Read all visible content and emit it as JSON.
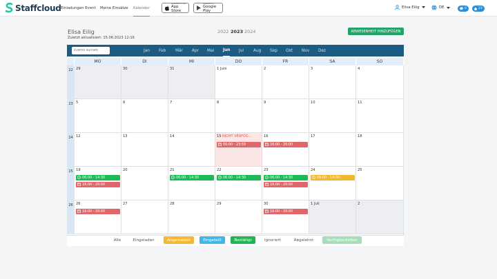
{
  "brand": {
    "name": "Staffcloud",
    "color": "#1f3b57",
    "accent": "#23c7a4"
  },
  "nav": [
    {
      "label": "Einladungen Event"
    },
    {
      "label": "Meine Einsätze"
    },
    {
      "label": "Kalender",
      "active": true
    }
  ],
  "stores": {
    "apple": {
      "small": "Available on the",
      "big": "App Store"
    },
    "google": {
      "small": "Available on",
      "big": "Google Play"
    }
  },
  "user": {
    "name": "Elisa Eilig"
  },
  "language": {
    "code": "DE"
  },
  "pills": {
    "left": "0",
    "right": "23"
  },
  "header": {
    "name": "Elisa Eilig",
    "updated": "Zuletzt aktualisiert: 15.06.2023 12:16",
    "years": [
      "2022",
      "2023",
      "2024"
    ],
    "active_year": "2023",
    "absence_button": "ABWESENHEIT HINZUFÜGEN"
  },
  "search": {
    "placeholder": "Events suchen"
  },
  "months": [
    "Jan",
    "Feb",
    "Mär",
    "Apr",
    "Mai",
    "Jun",
    "Jul",
    "Aug",
    "Sep",
    "Okt",
    "Nov",
    "Dez"
  ],
  "active_month": "Jun",
  "weekdays": [
    "MO",
    "DI",
    "MI",
    "DO",
    "FR",
    "SA",
    "SO"
  ],
  "weeks": [
    {
      "number": "22",
      "days": [
        "29",
        "30",
        "31",
        "1 Juni",
        "2",
        "3",
        "4"
      ]
    },
    {
      "number": "23",
      "days": [
        "5",
        "6",
        "7",
        "8",
        "9",
        "10",
        "11"
      ]
    },
    {
      "number": "24",
      "days": [
        "12",
        "13",
        "14",
        "15",
        "16",
        "17",
        "18"
      ]
    },
    {
      "number": "25",
      "days": [
        "19",
        "20",
        "21",
        "22",
        "23",
        "24",
        "25"
      ]
    },
    {
      "number": "26",
      "days": [
        "26",
        "27",
        "28",
        "29",
        "30",
        "1 Juli",
        "2"
      ]
    }
  ],
  "not_available_label": "NICHT VERFÜG...",
  "events": [
    {
      "time": "00:00 - 23:59"
    },
    {
      "time": "16:00 - 20:00"
    },
    {
      "time": "06:00 - 14:30"
    },
    {
      "time": "16:00 - 20:00"
    },
    {
      "time": "06:00 - 14:30"
    },
    {
      "time": "06:00 - 14:30"
    },
    {
      "time": "06:00 - 14:30"
    },
    {
      "time": "16:00 - 20:00"
    },
    {
      "time": "06:00 - 14:30"
    },
    {
      "time": "16:00 - 20:00"
    },
    {
      "time": "16:00 - 20:00"
    }
  ],
  "legend": [
    "Alle",
    "Eingeladen",
    "Angemeldet",
    "Eingeteilt",
    "Bestätigt",
    "Ignoriert",
    "Abgelehnt",
    "Verfügbarkeiten"
  ],
  "colors": {
    "header_bar": "#1b5c84",
    "confirmed": "#1db954",
    "busy": "#e06669",
    "registered": "#f5b731",
    "assigned": "#3fb7ea",
    "absence_button": "#23a36a"
  }
}
